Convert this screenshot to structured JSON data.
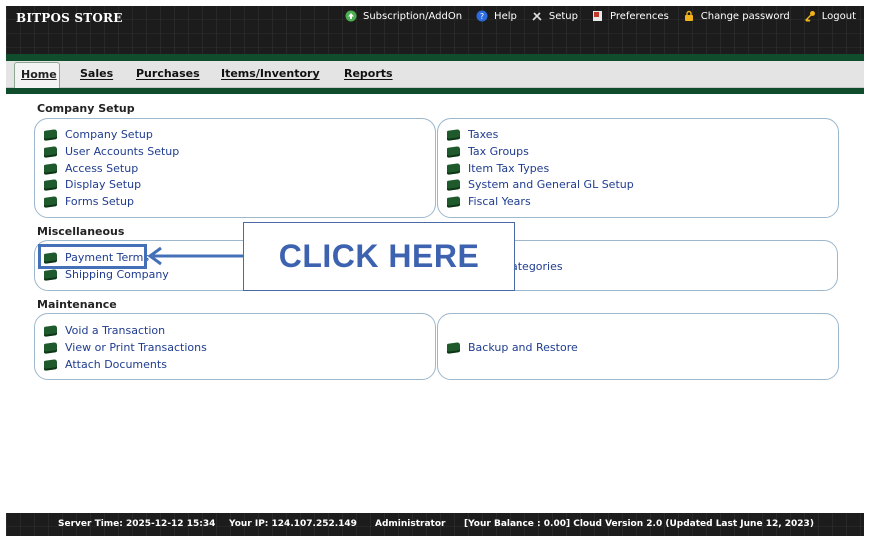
{
  "brand": "BITPOS STORE",
  "toplinks": {
    "subscription": "Subscription/AddOn",
    "help": "Help",
    "setup": "Setup",
    "preferences": "Preferences",
    "change_password": "Change password",
    "logout": "Logout"
  },
  "menu": {
    "home": "Home",
    "sales": "Sales",
    "purchases": "Purchases",
    "items": "Items/Inventory",
    "reports": "Reports"
  },
  "sections": {
    "company_setup": {
      "title": "Company Setup",
      "left": [
        "Company Setup",
        "User Accounts Setup",
        "Access Setup",
        "Display Setup",
        "Forms Setup"
      ],
      "right": [
        "Taxes",
        "Tax Groups",
        "Item Tax Types",
        "System and General GL Setup",
        "Fiscal Years"
      ]
    },
    "misc": {
      "title": "Miscellaneous",
      "left": [
        "Payment Terms",
        "Shipping Company"
      ],
      "right": [
        "ategories"
      ]
    },
    "maintenance": {
      "title": "Maintenance",
      "left": [
        "Void a Transaction",
        "View or Print Transactions",
        "Attach Documents"
      ],
      "right": [
        "Backup and Restore"
      ]
    }
  },
  "overlay": {
    "label": "CLICK HERE"
  },
  "footer": {
    "server_time": "Server Time: 2025-12-12 15:34",
    "ip": "Your IP: 124.107.252.149",
    "user": "Administrator",
    "balance": "[Your Balance : 0.00] Cloud Version 2.0 (Updated Last June 12, 2023)"
  },
  "colors": {
    "accent_green": "#0f4d2d",
    "link_blue": "#1f3c8f",
    "callout_blue": "#3c62b0"
  }
}
